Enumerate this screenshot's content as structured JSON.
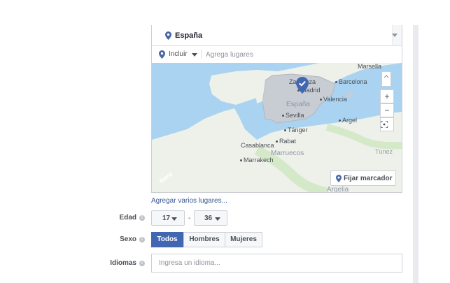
{
  "location": {
    "name": "España",
    "include_label": "Incluir",
    "place_placeholder": "Agrega lugares"
  },
  "map": {
    "cities": [
      {
        "name": "Marsella"
      },
      {
        "name": "Zaragoza"
      },
      {
        "name": "Madrid"
      },
      {
        "name": "Barcelona"
      },
      {
        "name": "Valencia"
      },
      {
        "name": "Sevilla"
      },
      {
        "name": "Tánger"
      },
      {
        "name": "Argel"
      },
      {
        "name": "Rabat"
      },
      {
        "name": "Casablanca"
      },
      {
        "name": "Marrakech"
      },
      {
        "name": "Túnez"
      }
    ],
    "countries": [
      "España",
      "Marruecos",
      "Argelia"
    ],
    "attribution": "here",
    "zoom_in": "+",
    "zoom_out": "−",
    "pin_button_label": "Fijar marcador",
    "colors": {
      "water": "#a9d3f0",
      "land": "#eef0ea",
      "selected_region": "#c8ccd3",
      "pin": "#4267b2"
    }
  },
  "add_places_link": "Agregar varios lugares...",
  "age": {
    "label": "Edad",
    "min": "17",
    "separator": "-",
    "max": "36"
  },
  "gender": {
    "label": "Sexo",
    "options": [
      "Todos",
      "Hombres",
      "Mujeres"
    ],
    "selected": "Todos"
  },
  "languages": {
    "label": "Idiomas",
    "placeholder": "Ingresa un idioma..."
  },
  "info_icon_glyph": "i",
  "accent_color": "#4267b2"
}
